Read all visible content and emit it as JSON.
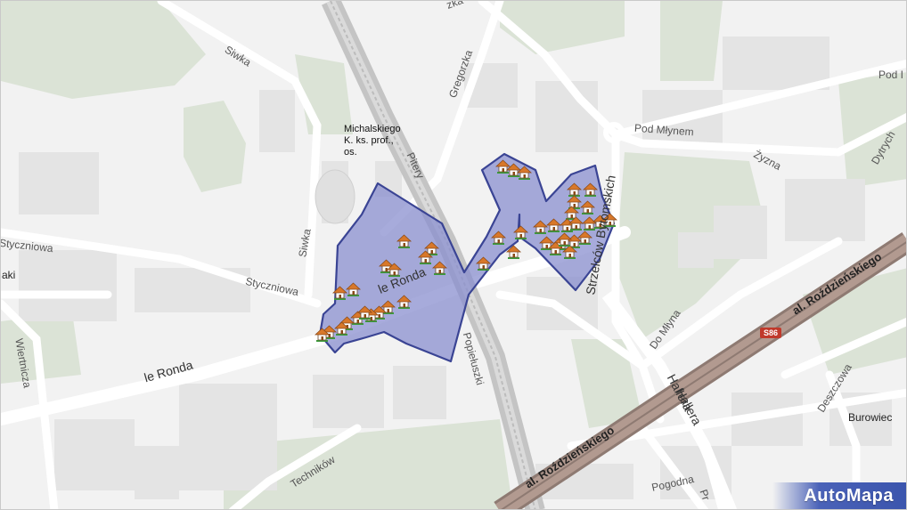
{
  "map": {
    "colors": {
      "background": "#f2f2f2",
      "block": "#e3e3e3",
      "green": "#dbe3d6",
      "road": "#ffffff",
      "rail": "#bdbdbd",
      "expressway": "#a88f86",
      "area_fill": "#8a8fcf",
      "area_stroke": "#3a4494"
    },
    "streets": [
      "Siwka",
      "Siwka",
      "Gregorzka",
      "Pitery",
      "Pod Młynem",
      "Pod I",
      "Żyzna",
      "Dytrych",
      "Styczniowa",
      "Styczniowa",
      "le Ronda",
      "le Ronda",
      "Strzelców Bytomskich",
      "Popiełuszki",
      "Do Młyna",
      "Wiertnicza",
      "Techników",
      "Hallera",
      "Hallera",
      "al. Roździeńskiego",
      "al. Roździeńskiego",
      "Deszczowa",
      "Pogodna",
      "Pr",
      "aki",
      "zka"
    ],
    "road_badge": "S86",
    "poi": "Michalskiego K. ks. prof., os.",
    "place": "Burowiec",
    "logo": "AutoMapa",
    "house_icon_count": 44
  }
}
